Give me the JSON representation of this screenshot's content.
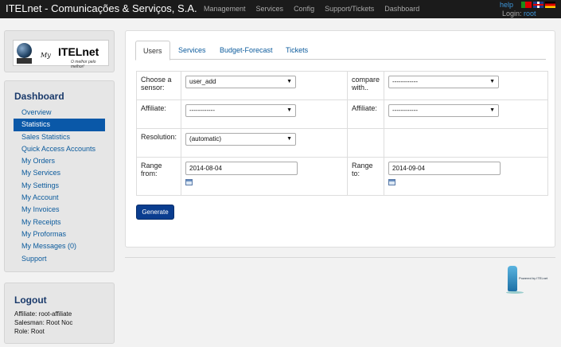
{
  "navbar": {
    "brand": "ITELnet - Comunicações & Serviços, S.A.",
    "items": [
      "Management",
      "Services",
      "Config",
      "Support/Tickets",
      "Dashboard"
    ],
    "help": "help",
    "login_label": "Login:",
    "login_user": "root",
    "flags": [
      "flag-pt-icon",
      "flag-uk-icon",
      "flag-de-icon"
    ]
  },
  "logo": {
    "my": "My",
    "name": "ITELnet",
    "tagline": "O melhor pelo melhor!"
  },
  "sidebar": {
    "title": "Dashboard",
    "items": [
      {
        "label": "Overview",
        "active": false
      },
      {
        "label": "Statistics",
        "active": true
      },
      {
        "label": "Sales Statistics",
        "active": false
      },
      {
        "label": "Quick Access Accounts",
        "active": false
      },
      {
        "label": "My Orders",
        "active": false
      },
      {
        "label": "My Services",
        "active": false
      },
      {
        "label": "My Settings",
        "active": false
      },
      {
        "label": "My Account",
        "active": false
      },
      {
        "label": "My Invoices",
        "active": false
      },
      {
        "label": "My Receipts",
        "active": false
      },
      {
        "label": "My Proformas",
        "active": false
      },
      {
        "label": "My Messages (0)",
        "active": false
      },
      {
        "label": "Support",
        "active": false
      }
    ]
  },
  "logout": {
    "title": "Logout",
    "affiliate": "Affiliate: root-affiliate",
    "salesman": "Salesman: Root Noc",
    "role": "Role: Root"
  },
  "tabs": [
    "Users",
    "Services",
    "Budget-Forecast",
    "Tickets"
  ],
  "form": {
    "choose_sensor_label": "Choose a sensor:",
    "choose_sensor_value": "user_add",
    "compare_label": "compare with..",
    "compare_value": "------------",
    "affiliate_label": "Affiliate:",
    "affiliate_value": "------------",
    "affiliate2_label": "Affiliate:",
    "affiliate2_value": "------------",
    "resolution_label": "Resolution:",
    "resolution_value": "(automatic)",
    "range_from_label": "Range from:",
    "range_from_value": "2014-08-04",
    "range_to_label": "Range to:",
    "range_to_value": "2014-09-04",
    "generate_label": "Generate"
  },
  "powered_by": "Powered by ITELnet"
}
